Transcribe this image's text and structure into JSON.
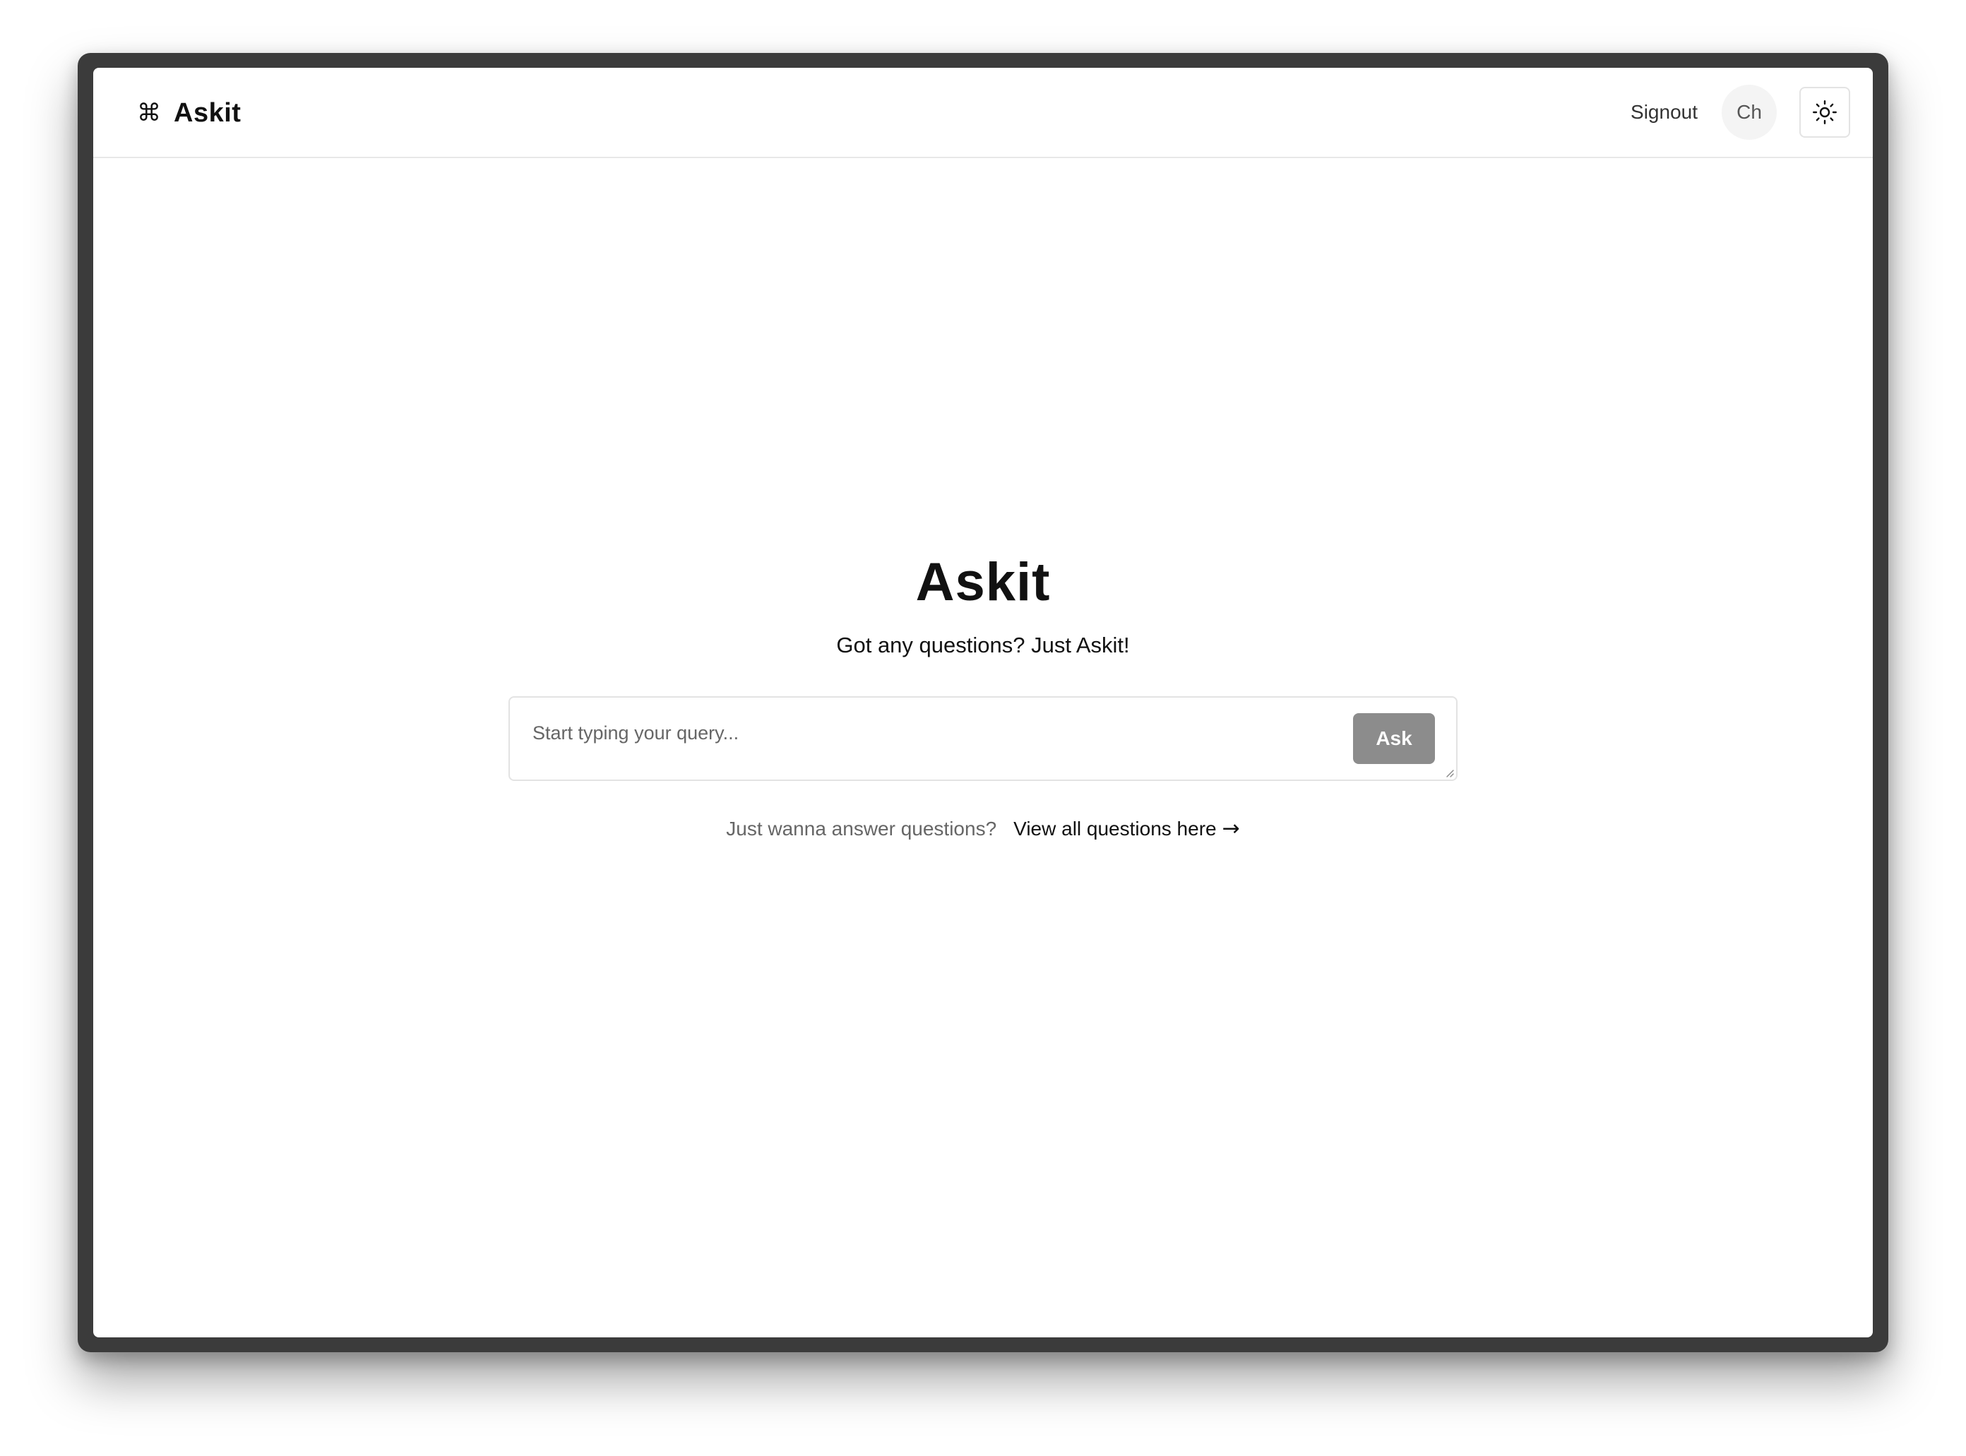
{
  "header": {
    "brand_icon": "⌘",
    "brand_icon_name": "command-icon",
    "brand_name": "Askit",
    "signout_label": "Signout",
    "avatar_initials": "Ch",
    "theme_icon_name": "sun-icon"
  },
  "hero": {
    "title": "Askit",
    "subtitle": "Got any questions? Just Askit!"
  },
  "query": {
    "placeholder": "Start typing your query...",
    "value": "",
    "ask_label": "Ask"
  },
  "answer": {
    "hint": "Just wanna answer questions?",
    "link_label": "View all questions here",
    "link_icon": "→",
    "link_icon_name": "arrow-right-icon"
  },
  "colors": {
    "ask_button_bg": "#8c8c8c",
    "frame": "#3b3b3b",
    "divider": "#e8e8e8"
  }
}
